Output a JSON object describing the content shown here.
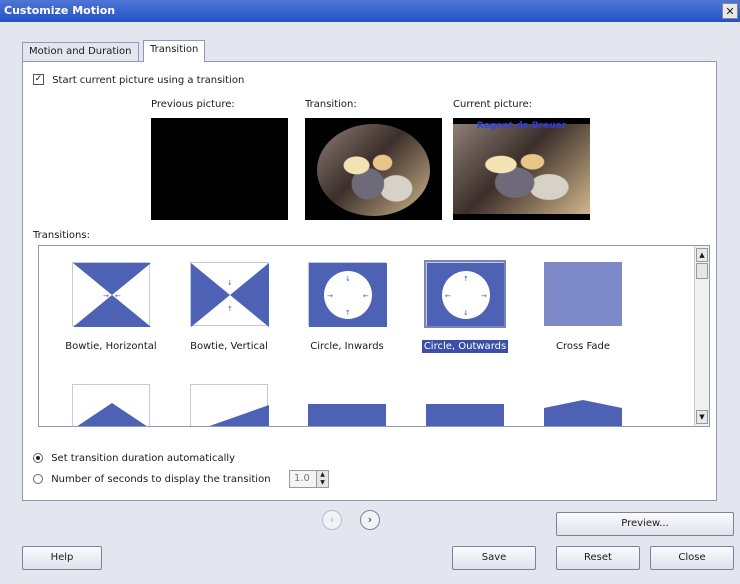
{
  "window": {
    "title": "Customize Motion",
    "close_glyph": "✕"
  },
  "tabs": [
    {
      "label": "Motion and Duration",
      "active": false
    },
    {
      "label": "Transition",
      "active": true
    }
  ],
  "start_transition": {
    "checked": true,
    "check_glyph": "✓",
    "label": "Start current picture using a transition"
  },
  "previews": {
    "previous_label": "Previous picture:",
    "transition_label": "Transition:",
    "current_label": "Current picture:",
    "current_caption": "Regent de Breuer"
  },
  "transitions_list": {
    "label": "Transitions:",
    "items": [
      {
        "label": "Bowtie, Horizontal",
        "icon": "bowtie-horizontal-icon",
        "selected": false
      },
      {
        "label": "Bowtie, Vertical",
        "icon": "bowtie-vertical-icon",
        "selected": false
      },
      {
        "label": "Circle, Inwards",
        "icon": "circle-inwards-icon",
        "selected": false
      },
      {
        "label": "Circle, Outwards",
        "icon": "circle-outwards-icon",
        "selected": true
      },
      {
        "label": "Cross Fade",
        "icon": "cross-fade-icon",
        "selected": false
      }
    ],
    "scroll_up": "▲",
    "scroll_down": "▼"
  },
  "duration": {
    "auto_label": "Set transition duration automatically",
    "auto_selected": true,
    "manual_label": "Number of seconds to display the transition",
    "manual_selected": false,
    "seconds_value": "1.0",
    "spin_up": "▲",
    "spin_down": "▼"
  },
  "nav": {
    "prev_glyph": "‹",
    "next_glyph": "›"
  },
  "buttons": {
    "preview": "Preview...",
    "help": "Help",
    "save": "Save",
    "reset": "Reset",
    "close": "Close"
  },
  "colors": {
    "accent": "#4d62b5",
    "selection": "#3b4fa8",
    "title_bar": "#2352c6"
  }
}
